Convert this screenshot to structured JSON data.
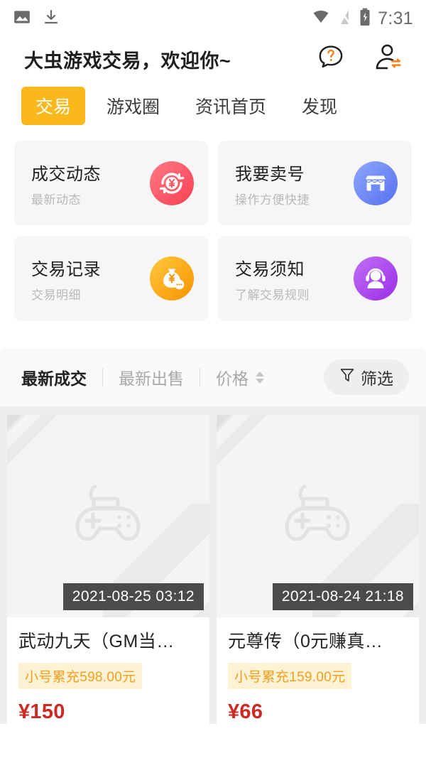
{
  "statusbar": {
    "time": "7:31",
    "left_icons": [
      "image-icon",
      "download-icon"
    ],
    "right_icons": [
      "wifi-icon",
      "signal-off-icon",
      "battery-charging-icon"
    ]
  },
  "header": {
    "title": "大虫游戏交易，欢迎你~",
    "help_icon": "question-bubble-icon",
    "account_switch_icon": "user-switch-icon",
    "accent_color": "#f4821f"
  },
  "tabs": {
    "active_index": 0,
    "active_bg": "#fab81b",
    "items": [
      {
        "label": "交易"
      },
      {
        "label": "游戏圈"
      },
      {
        "label": "资讯首页"
      },
      {
        "label": "发现"
      }
    ]
  },
  "entry_cards": [
    {
      "title": "成交动态",
      "subtitle": "最新动态",
      "icon": "yen-refresh-icon",
      "color": "#f8555e"
    },
    {
      "title": "我要卖号",
      "subtitle": "操作方便快捷",
      "icon": "shop-icon",
      "color": "#6d8cf7"
    },
    {
      "title": "交易记录",
      "subtitle": "交易明细",
      "icon": "money-bag-icon",
      "color": "#fbad1a"
    },
    {
      "title": "交易须知",
      "subtitle": "了解交易规则",
      "icon": "headset-support-icon",
      "color": "#b04ef0"
    }
  ],
  "filter_bar": {
    "tabs": [
      {
        "label": "最新成交",
        "active": true
      },
      {
        "label": "最新出售",
        "active": false
      },
      {
        "label": "价格",
        "active": false,
        "sortable": true
      }
    ],
    "filter_button": {
      "label": "筛选",
      "icon": "funnel-icon"
    }
  },
  "products": [
    {
      "timestamp": "2021-08-25 03:12",
      "title": "武动九天（GM当…",
      "badge": "小号累充598.00元",
      "price": "¥150",
      "thumb_icon": "gamepad-placeholder-icon"
    },
    {
      "timestamp": "2021-08-24 21:18",
      "title": "元尊传（0元赚真…",
      "badge": "小号累充159.00元",
      "price": "¥66",
      "thumb_icon": "gamepad-placeholder-icon"
    }
  ]
}
